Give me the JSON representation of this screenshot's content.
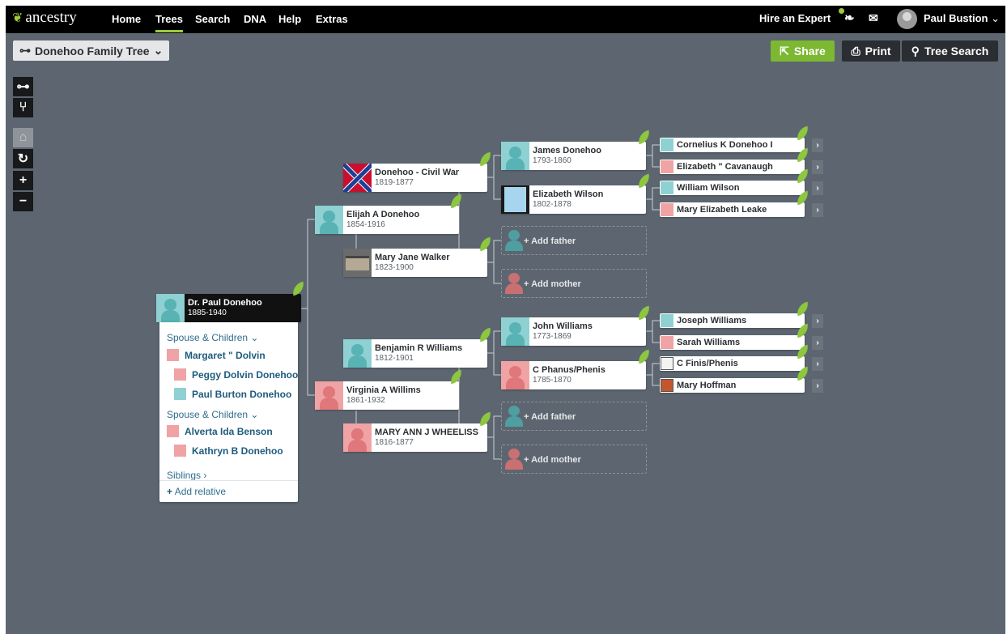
{
  "nav": {
    "logo": "ancestry",
    "items": [
      "Home",
      "Trees",
      "Search",
      "DNA",
      "Help",
      "Extras"
    ],
    "hire": "Hire an Expert",
    "user": "Paul Bustion"
  },
  "toolbar": {
    "tree_name": "Donehoo Family Tree",
    "share": "Share",
    "print": "Print",
    "tree_search": "Tree Search"
  },
  "focus": {
    "name": "Dr. Paul Donehoo",
    "dates": "1885-1940"
  },
  "panel": {
    "spouse_header_1": "Spouse & Children",
    "spouse_1": "Margaret \" Dolvin",
    "child_1a": "Peggy Dolvin Donehoo",
    "child_1b": "Paul Burton Donehoo",
    "spouse_header_2": "Spouse & Children",
    "spouse_2": "Alverta Ida Benson",
    "child_2a": "Kathryn B Donehoo",
    "siblings": "Siblings",
    "add_relative": "Add relative"
  },
  "gen2": {
    "father": {
      "name": "Elijah A Donehoo",
      "dates": "1854-1916"
    },
    "mother": {
      "name": "Virginia A Willims",
      "dates": "1861-1932"
    }
  },
  "gen3": {
    "ff": {
      "name": "Donehoo - Civil War",
      "dates": "1819-1877"
    },
    "fm": {
      "name": "Mary Jane Walker",
      "dates": "1823-1900"
    },
    "mf": {
      "name": "Benjamin R Williams",
      "dates": "1812-1901"
    },
    "mm": {
      "name": "MARY ANN J WHEELISS",
      "dates": "1816-1877"
    }
  },
  "gen4": {
    "fff": {
      "name": "James Donehoo",
      "dates": "1793-1860"
    },
    "ffm": {
      "name": "Elizabeth Wilson",
      "dates": "1802-1878"
    },
    "mff": {
      "name": "John Williams",
      "dates": "1773-1869"
    },
    "mfm": {
      "name": "C Phanus/Phenis",
      "dates": "1785-1870"
    }
  },
  "add": {
    "father": "Add father",
    "mother": "Add mother"
  },
  "gen5": [
    "Cornelius K Donehoo I",
    "Elizabeth \" Cavanaugh",
    "William Wilson",
    "Mary Elizabeth Leake",
    "Joseph Williams",
    "Sarah Williams",
    "C Finis/Phenis",
    "Mary Hoffman"
  ]
}
